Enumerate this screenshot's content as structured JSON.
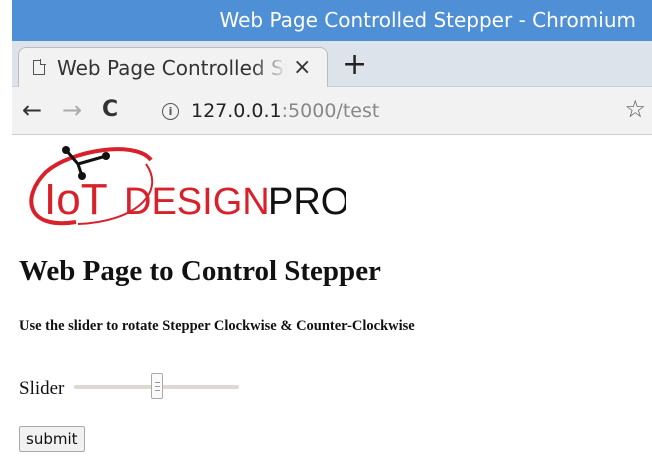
{
  "window": {
    "title": "Web Page Controlled Stepper - Chromium"
  },
  "tab": {
    "title": "Web Page Controlled Stepper",
    "close": "×"
  },
  "new_tab": "+",
  "nav": {
    "back": "←",
    "forward": "→",
    "reload": "C"
  },
  "address": {
    "info": "i",
    "host": "127.0.0.1",
    "rest": ":5000/test"
  },
  "bookmark": "☆",
  "logo": {
    "iot": "IoT",
    "design": "DESIGN",
    "pro": "PRO"
  },
  "page": {
    "heading": "Web Page to Control Stepper",
    "subtext": "Use the slider to rotate Stepper Clockwise & Counter-Clockwise",
    "slider_label": "Slider",
    "slider_value": 0.5,
    "submit_label": "submit"
  },
  "colors": {
    "titlebar": "#4e8fd6",
    "logo_red": "#d8212a",
    "logo_black": "#111111"
  }
}
